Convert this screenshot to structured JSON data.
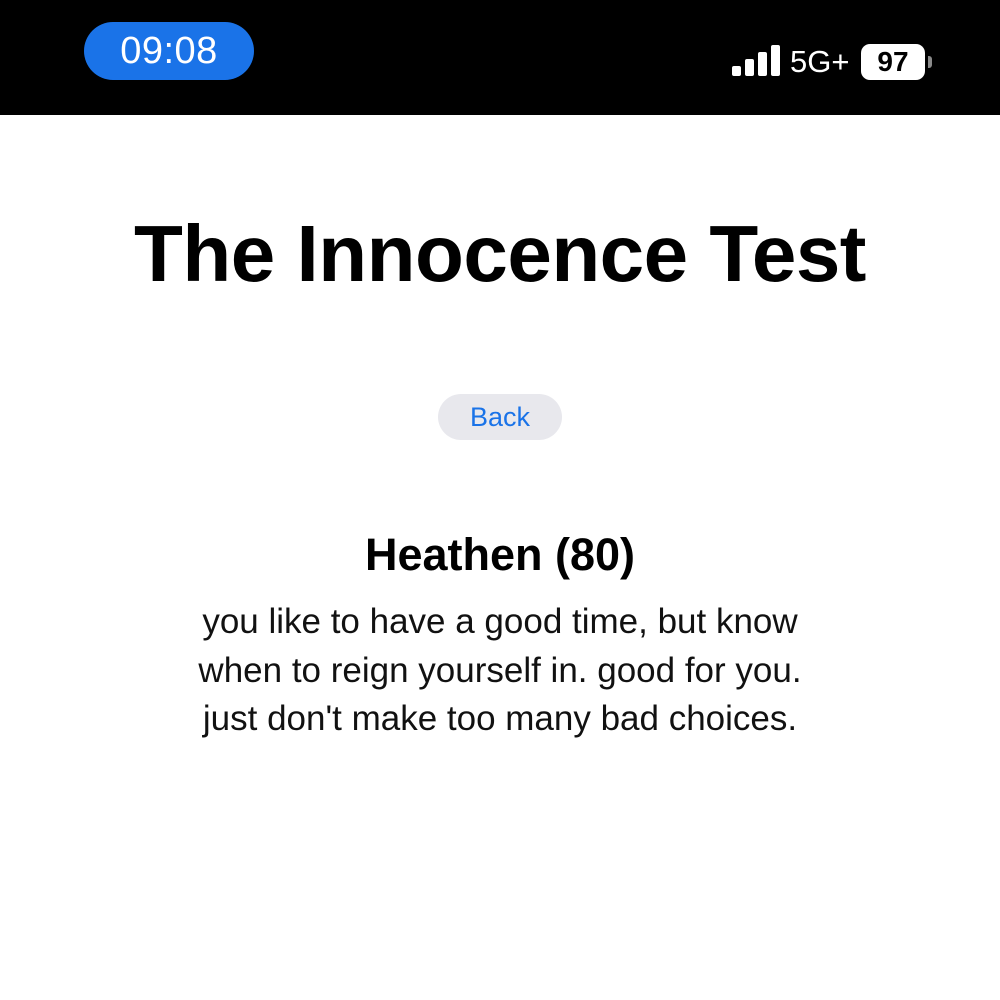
{
  "status_bar": {
    "time": "09:08",
    "network": "5G+",
    "battery": "97",
    "signal_icon": "cellular-signal-icon",
    "accent_color": "#1a73e8"
  },
  "page": {
    "title": "The Innocence Test",
    "back_label": "Back"
  },
  "result": {
    "heading": "Heathen (80)",
    "description": "you like to have a good time, but know when to reign yourself in. good for you. just don't make too many bad choices."
  }
}
